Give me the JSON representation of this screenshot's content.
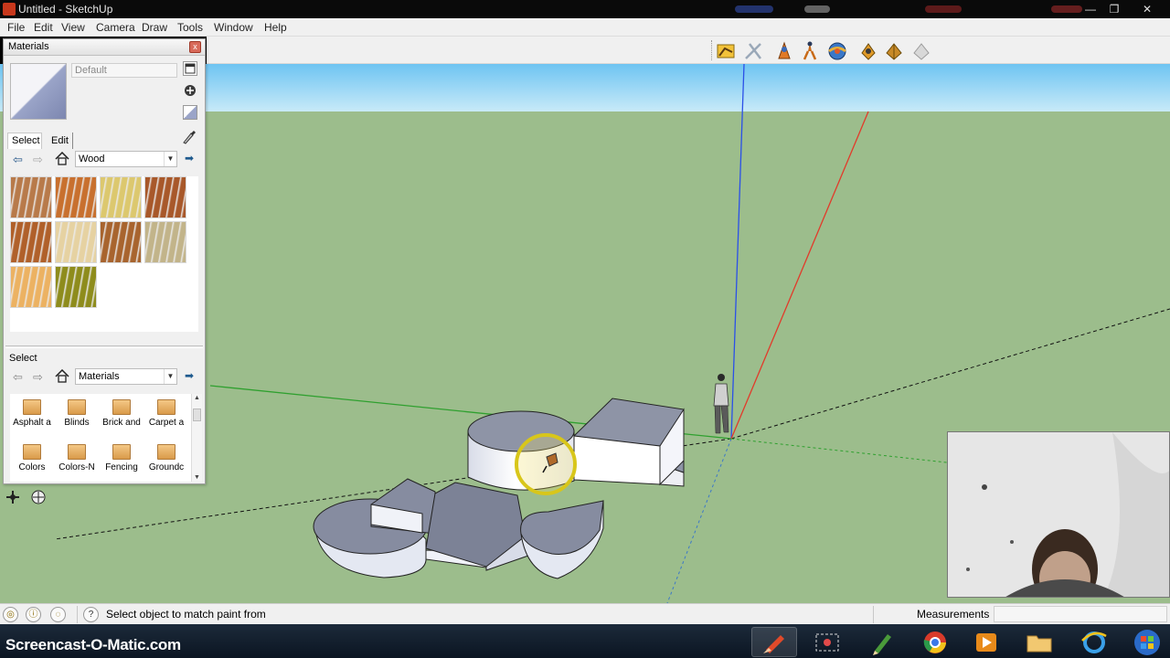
{
  "window": {
    "title": "Untitled - SketchUp",
    "minimize_glyph": "—",
    "maximize_glyph": "❐",
    "close_glyph": "✕"
  },
  "menu": [
    "File",
    "Edit",
    "View",
    "Camera",
    "Draw",
    "Tools",
    "Window",
    "Help"
  ],
  "toolbar_icons": [
    "styles-icon",
    "walk-icon",
    "section-plane-icon",
    "position-camera-icon",
    "orbit-icon",
    "component-icon",
    "dynamic-component-icon",
    "sandbox-icon"
  ],
  "materials_panel": {
    "title": "Materials",
    "close_glyph": "x",
    "material_name": "Default",
    "tabs": [
      "Select",
      "Edit"
    ],
    "collection": "Wood",
    "swatch_colors": [
      "#b87a4a",
      "#c8702e",
      "#dcc86e",
      "#a8582a",
      "#b0602a",
      "#e6d2a2",
      "#a8642e",
      "#c2b48a",
      "#ecb262",
      "#8e8c1c"
    ],
    "secondary_label": "Select",
    "secondary_collection": "Materials",
    "libraries": [
      "Asphalt a",
      "Blinds",
      "Brick and",
      "Carpet a",
      "Colors",
      "Colors-N",
      "Fencing",
      "Groundc"
    ]
  },
  "status": {
    "hint": "Select object to match paint from",
    "measurements_label": "Measurements",
    "measurements_value": ""
  },
  "taskbar": {
    "watermark": "Screencast-O-Matic.com",
    "apps": [
      "sketchup-icon",
      "snipping-tool-icon",
      "notepad-icon",
      "chrome-icon",
      "media-player-icon",
      "explorer-icon",
      "ie-icon",
      "windows-logo-icon"
    ]
  }
}
